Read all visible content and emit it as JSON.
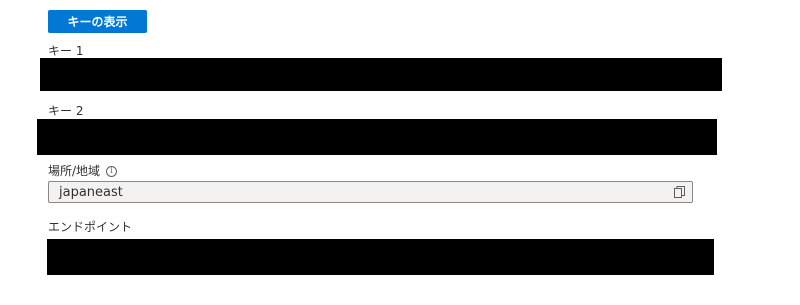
{
  "toolbar": {
    "show_keys_label": "キーの表示"
  },
  "fields": {
    "key1": {
      "label": "キー 1"
    },
    "key2": {
      "label": "キー 2"
    },
    "location": {
      "label": "場所/地域",
      "info_icon": "info-icon",
      "value": "japaneast",
      "copy_icon": "copy-icon"
    },
    "endpoint": {
      "label": "エンドポイント"
    }
  },
  "colors": {
    "accent": "#0078d4",
    "redaction": "#000000",
    "readonly_field_bg": "#f3f2f1"
  }
}
